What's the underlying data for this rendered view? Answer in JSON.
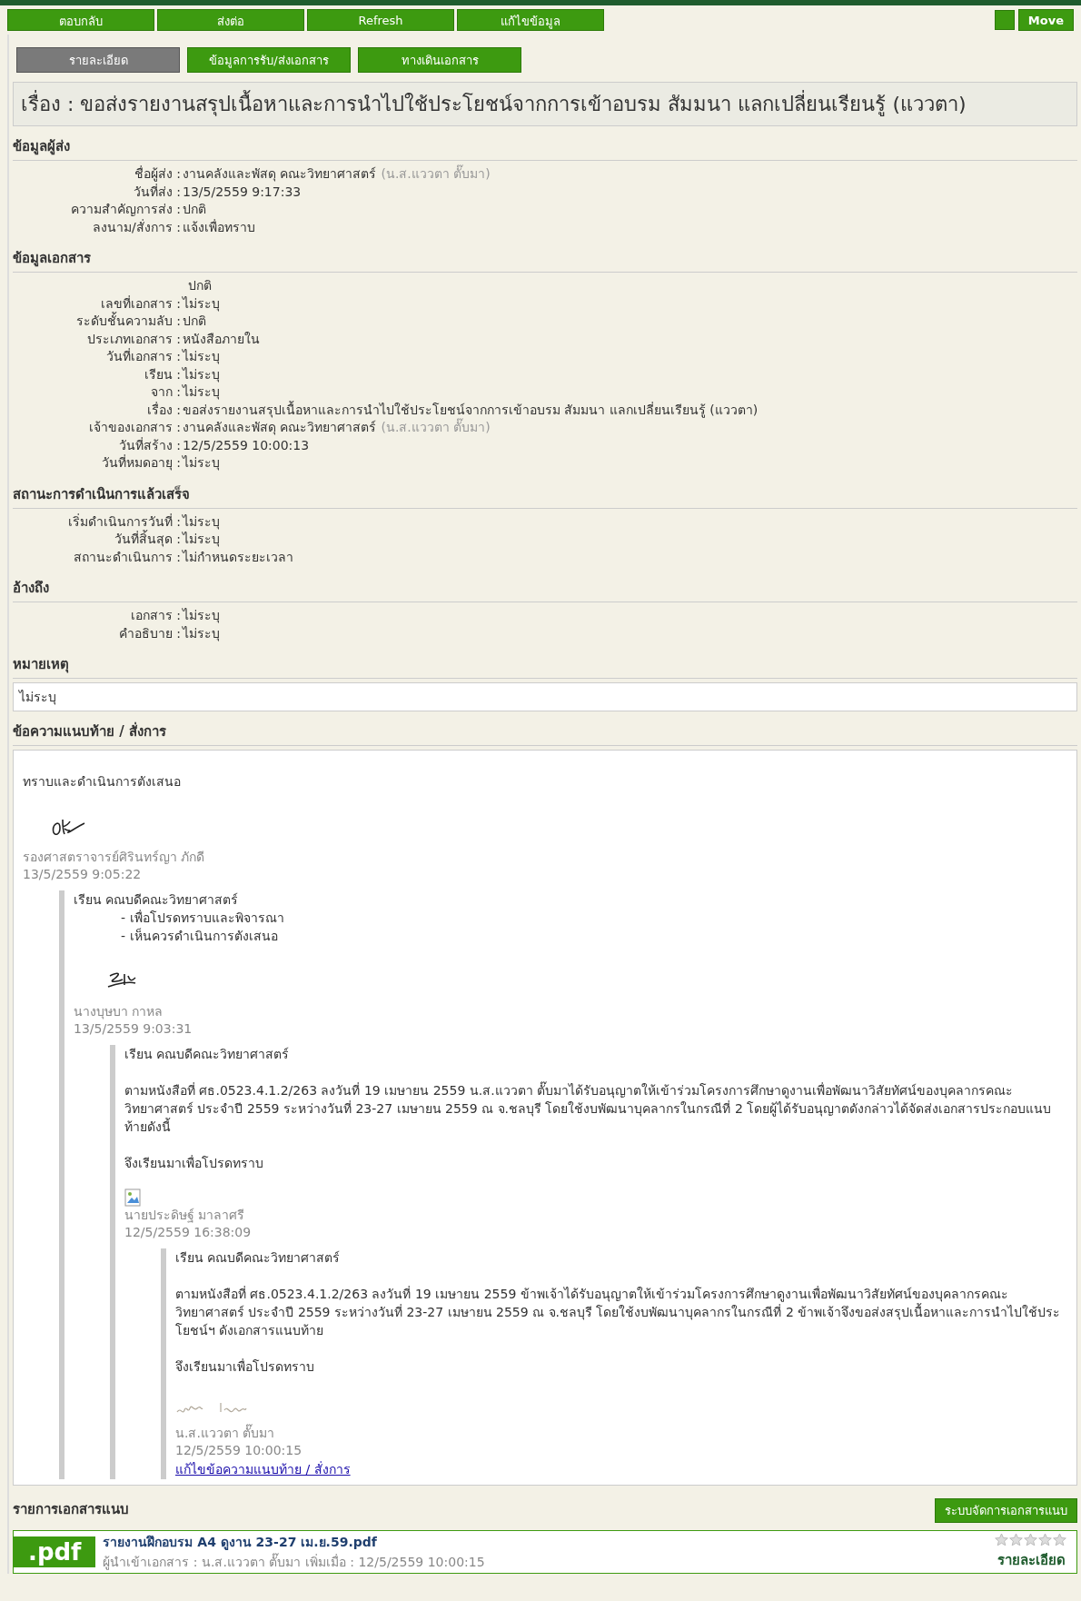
{
  "toolbar": {
    "buttons": [
      "ตอบกลับ",
      "ส่งต่อ",
      "Refresh",
      "แก้ไขข้อมูล"
    ],
    "move_button": "Move"
  },
  "tabs": [
    {
      "label": "รายละเอียด",
      "selected": true
    },
    {
      "label": "ข้อมูลการรับ/ส่งเอกสาร",
      "selected": false
    },
    {
      "label": "ทางเดินเอกสาร",
      "selected": false
    }
  ],
  "title": "เรื่อง : ขอส่งรายงานสรุปเนื้อหาและการนำไปใช้ประโยชน์จากการเข้าอบรม สัมมนา แลกเปลี่ยนเรียนรู้ (แววตา)",
  "sections": [
    {
      "heading": "ข้อมูลผู้ส่ง",
      "fields": [
        {
          "label": "ชื่อผู้ส่ง :",
          "value": "งานคลังและพัสดุ คณะวิทยาศาสตร์",
          "note": "(น.ส.แววตา ตั๊บมา)"
        },
        {
          "label": "วันที่ส่ง :",
          "value": "13/5/2559 9:17:33"
        },
        {
          "label": "ความสำคัญการส่ง :",
          "value": "ปกติ"
        },
        {
          "label": "ลงนาม/สั่งการ :",
          "value": "แจ้งเพื่อทราบ"
        }
      ]
    },
    {
      "heading": "ข้อมูลเอกสาร",
      "fields": [
        {
          "value": "ปกติ"
        },
        {
          "label": "เลขที่เอกสาร :",
          "value": "ไม่ระบุ"
        },
        {
          "label": "ระดับชั้นความลับ :",
          "value": "ปกติ"
        },
        {
          "label": "ประเภทเอกสาร :",
          "value": "หนังสือภายใน"
        },
        {
          "label": "วันที่เอกสาร :",
          "value": "ไม่ระบุ"
        },
        {
          "label": "เรียน :",
          "value": "ไม่ระบุ"
        },
        {
          "label": "จาก :",
          "value": "ไม่ระบุ"
        },
        {
          "label": "เรื่อง :",
          "value": "ขอส่งรายงานสรุปเนื้อหาและการนำไปใช้ประโยชน์จากการเข้าอบรม สัมมนา แลกเปลี่ยนเรียนรู้ (แววตา)"
        },
        {
          "label": "เจ้าของเอกสาร :",
          "value": "งานคลังและพัสดุ คณะวิทยาศาสตร์",
          "note": "(น.ส.แววตา ตั๊บมา)"
        },
        {
          "label": "วันที่สร้าง :",
          "value": "12/5/2559 10:00:13"
        },
        {
          "label": "วันที่หมดอายุ :",
          "value": "ไม่ระบุ"
        }
      ]
    },
    {
      "heading": "สถานะการดำเนินการแล้วเสร็จ",
      "fields": [
        {
          "label": "เริ่มดำเนินการวันที่ :",
          "value": "ไม่ระบุ"
        },
        {
          "label": "วันที่สิ้นสุด :",
          "value": "ไม่ระบุ"
        },
        {
          "label": "สถานะดำเนินการ :",
          "value": "ไม่กำหนดระยะเวลา"
        }
      ]
    },
    {
      "heading": "อ้างถึง",
      "fields": [
        {
          "label": "เอกสาร :",
          "value": "ไม่ระบุ"
        },
        {
          "label": "คำอธิบาย :",
          "value": "ไม่ระบุ"
        }
      ]
    }
  ],
  "remark": {
    "heading": "หมายเหตุ",
    "text": "ไม่ระบุ"
  },
  "comments": {
    "heading": "ข้อความแนบท้าย / สั่งการ",
    "thread": {
      "paragraphs": [
        {
          "kind": "para",
          "text": "ทราบและดำเนินการตังเสนอ"
        }
      ],
      "signature": {
        "kind": "initials"
      },
      "author": "รองศาสตราจารย์ศิรินทร์ญา ภักดี",
      "date": "13/5/2559 9:05:22",
      "children": [
        {
          "paragraphs": [
            {
              "kind": "para",
              "text": "เรียน  คณบดีคณะวิทยาศาสตร์"
            },
            {
              "kind": "sub",
              "text": "- เพื่อโปรดทราบและพิจารณา"
            },
            {
              "kind": "sub",
              "text": "- เห็นควรดำเนินการตังเสนอ"
            }
          ],
          "signature": {
            "kind": "scrawl"
          },
          "author": "นางบุษบา กาหล",
          "date": "13/5/2559 9:03:31",
          "children": [
            {
              "paragraphs": [
                {
                  "kind": "para",
                  "text": "เรียน  คณบดีคณะวิทยาศาสตร์"
                },
                {
                  "kind": "para",
                  "text": "ตามหนังสือที่ ศธ.0523.4.1.2/263  ลงวันที่ 19 เมษายน 2559  น.ส.แววตา ตั๊บมาได้รับอนุญาตให้เข้าร่วมโครงการศึกษาดูงานเพื่อพัฒนาวิสัยทัศน์ของบุคลากรคณะวิทยาศาสตร์ ประจำปี 2559 ระหว่างวันที่ 23-27 เมษายน  2559 ณ จ.ชลบุรี  โดยใช้งบพัฒนาบุคลากรในกรณีที่ 2  โดยผู้ได้รับอนุญาตดังกล่าวได้จัดส่งเอกสารประกอบแนบท้ายดังนี้"
                },
                {
                  "kind": "para",
                  "text": "จึงเรียนมาเพื่อโปรดทราบ"
                }
              ],
              "signature": {
                "kind": "broken-image"
              },
              "author": "นายประดิษฐ์ มาลาศรี",
              "date": "12/5/2559 16:38:09",
              "children": [
                {
                  "paragraphs": [
                    {
                      "kind": "para",
                      "text": "เรียน  คณบดีคณะวิทยาศาสตร์"
                    },
                    {
                      "kind": "para",
                      "text": "ตามหนังสือที่ ศธ.0523.4.1.2/263  ลงวันที่ 19 เมษายน 2559  ข้าพเจ้าได้รับอนุญาตให้เข้าร่วมโครงการศึกษาดูงานเพื่อพัฒนาวิสัยทัศน์ของบุคลากรคณะวิทยาศาสตร์ ประจำปี 2559 ระหว่างวันที่ 23-27 เมษายน  2559 ณ จ.ชลบุรี  โดยใช้งบพัฒนาบุคลากรในกรณีที่ 2  ข้าพเจ้าจึงขอส่งสรุปเนื้อหาและการนำไปใช้ประโยชน์ฯ ดังเอกสารแนบท้าย"
                    },
                    {
                      "kind": "para",
                      "text": "จึงเรียนมาเพื่อโปรดทราบ"
                    }
                  ],
                  "signature": {
                    "kind": "handwriting"
                  },
                  "author": "น.ส.แววตา ตั๊บมา",
                  "date": "12/5/2559 10:00:15",
                  "edit_link": "แก้ไขข้อความแนบท้าย / สั่งการ"
                }
              ]
            }
          ]
        }
      ]
    }
  },
  "attachments": {
    "heading": "รายการเอกสารแนบ",
    "manage_button": "ระบบจัดการเอกสารแนบ",
    "files": [
      {
        "extension": ".pdf",
        "name": "รายงานฝึกอบรม A4 ดูงาน 23-27 เม.ย.59.pdf",
        "meta": "ผู้นำเข้าเอกสาร :  น.ส.แววตา ตั๊บมา เพิ่มเมื่อ : 12/5/2559 10:00:15",
        "stars": 0,
        "detail_link": "รายละเอียด"
      }
    ]
  }
}
